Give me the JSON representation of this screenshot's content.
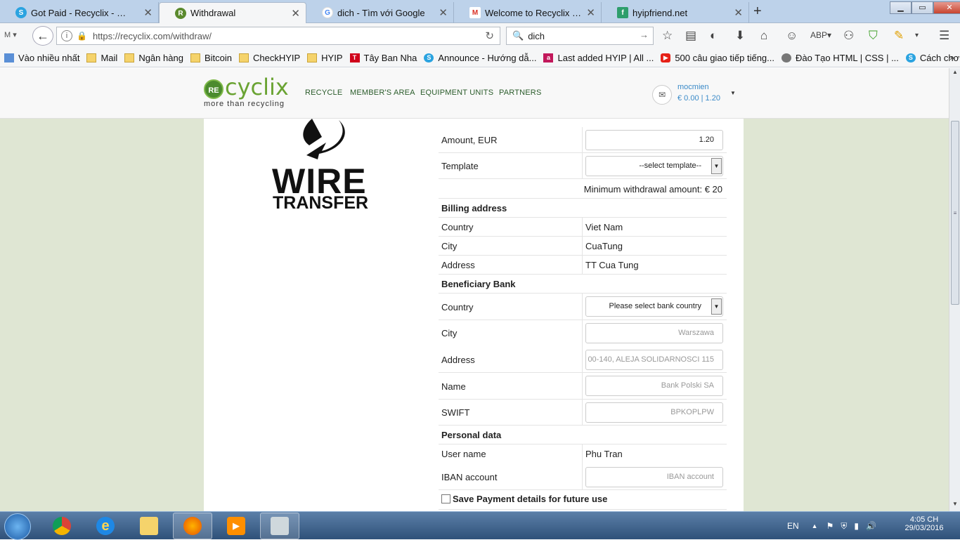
{
  "tabs": [
    {
      "label": "Got Paid - Recyclix - Recycl...",
      "favicon": "skype-icon",
      "color": "#2aa3e0",
      "active": false
    },
    {
      "label": "Withdrawal",
      "favicon": "recyclix-icon",
      "color": "#5b8a2e",
      "active": true
    },
    {
      "label": "dich - Tìm với Google",
      "favicon": "google-icon",
      "color": "#4285f4",
      "active": false
    },
    {
      "label": "Welcome to Recyclix - ruo...",
      "favicon": "gmail-icon",
      "color": "#d93025",
      "active": false
    },
    {
      "label": "hyipfriend.net",
      "favicon": "hyipfriend-icon",
      "color": "#2e9e6c",
      "active": false
    }
  ],
  "window_controls": {
    "minimize": "▁",
    "maximize": "▭",
    "close": "✕"
  },
  "nav": {
    "url": "https://recyclix.com/withdraw/",
    "url_host": "recyclix.com",
    "search_value": "dich"
  },
  "bookmarks": [
    {
      "label": "Vào nhiều nhất",
      "icon": "bookmarks-icon"
    },
    {
      "label": "Mail",
      "icon": "folder-icon"
    },
    {
      "label": "Ngân hàng",
      "icon": "folder-icon"
    },
    {
      "label": "Bitcoin",
      "icon": "folder-icon"
    },
    {
      "label": "CheckHYIP",
      "icon": "folder-icon"
    },
    {
      "label": "HYIP",
      "icon": "folder-icon"
    },
    {
      "label": "Tây Ban Nha",
      "icon": "t-icon"
    },
    {
      "label": "Announce - Hướng dẫ...",
      "icon": "skype-icon"
    },
    {
      "label": "Last added HYIP | All ...",
      "icon": "a-icon"
    },
    {
      "label": "500 câu giao tiếp tiếng...",
      "icon": "youtube-icon"
    },
    {
      "label": "Đào Tạo HTML | CSS | ...",
      "icon": "globe-icon"
    },
    {
      "label": "Cách chơi CPM không...",
      "icon": "skype-icon"
    }
  ],
  "site": {
    "logo_badge": "RE",
    "logo_text": "cyclix",
    "logo_tagline": "more than recycling",
    "nav": [
      "RECYCLE",
      "MEMBER'S AREA",
      "EQUIPMENT UNITS",
      "PARTNERS"
    ],
    "username": "mocmien",
    "balance": "€ 0.00 | 1.20"
  },
  "wire": {
    "word1": "WIRE",
    "word2": "TRANSFER"
  },
  "form": {
    "amount_label": "Amount, EUR",
    "amount_value": "1.20",
    "template_label": "Template",
    "template_value": "--select template--",
    "min_withdrawal": "Minimum withdrawal amount: € 20",
    "billing_header": "Billing address",
    "billing_country_label": "Country",
    "billing_country": "Viet Nam",
    "billing_city_label": "City",
    "billing_city": "CuaTung",
    "billing_address_label": "Address",
    "billing_address": "TT Cua Tung",
    "bank_header": "Beneficiary Bank",
    "bank_country_label": "Country",
    "bank_country_value": "Please select bank country",
    "bank_city_label": "City",
    "bank_city_placeholder": "Warszawa",
    "bank_address_label": "Address",
    "bank_address_placeholder": "00-140, ALEJA SOLIDARNOSCI 115",
    "bank_name_label": "Name",
    "bank_name_placeholder": "Bank Polski SA",
    "swift_label": "SWIFT",
    "swift_placeholder": "BPKOPLPW",
    "personal_header": "Personal data",
    "user_name_label": "User name",
    "user_name": "Phu Tran",
    "iban_label": "IBAN account",
    "iban_placeholder": "IBAN account",
    "save_label": "Save Payment details for future use"
  },
  "taskbar": {
    "apps": [
      "chrome-icon",
      "ie-icon",
      "explorer-icon",
      "firefox-icon",
      "media-player-icon",
      "calculator-icon"
    ],
    "language": "EN",
    "time": "4:05 CH",
    "date": "29/03/2016"
  }
}
